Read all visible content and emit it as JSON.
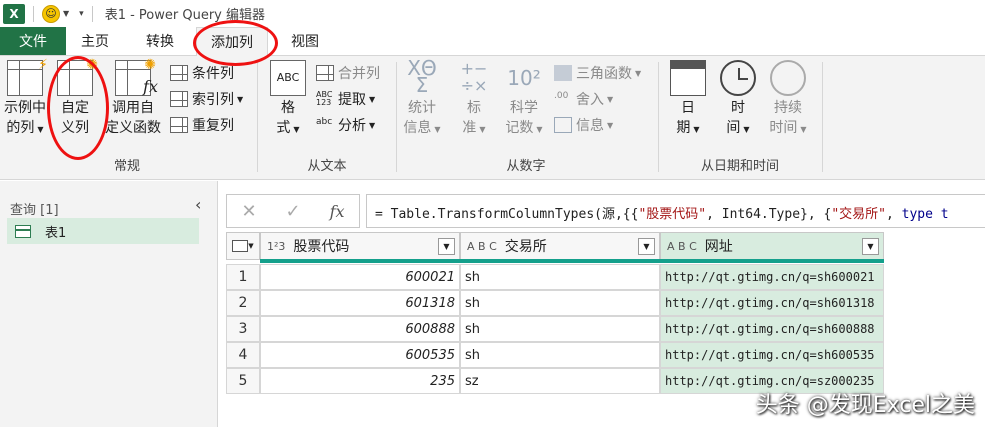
{
  "titlebar": {
    "app_icon": "X",
    "title": "表1 - Power Query 编辑器"
  },
  "menu": {
    "file": "文件",
    "home": "主页",
    "transform": "转换",
    "add_column": "添加列",
    "view": "视图"
  },
  "ribbon": {
    "general": {
      "label": "常规",
      "example_col": [
        "示例中",
        "的列"
      ],
      "custom_col": [
        "自定",
        "义列"
      ],
      "invoke_fn": [
        "调用自",
        "定义函数"
      ],
      "conditional_col": "条件列",
      "index_col": "索引列",
      "duplicate_col": "重复列"
    },
    "from_text": {
      "label": "从文本",
      "format": [
        "格",
        "式"
      ],
      "merge_col": "合并列",
      "extract": "提取",
      "parse": "分析"
    },
    "from_number": {
      "label": "从数字",
      "statistics": [
        "统计",
        "信息"
      ],
      "standard": [
        "标",
        "准"
      ],
      "scientific": [
        "科学",
        "记数"
      ],
      "trig": "三角函数",
      "rounding": "舍入",
      "information": "信息"
    },
    "from_datetime": {
      "label": "从日期和时间",
      "date": [
        "日",
        "期"
      ],
      "time": [
        "时",
        "间"
      ],
      "duration": [
        "持续",
        "时间"
      ]
    }
  },
  "queries": {
    "header": "查询 [1]",
    "items": [
      {
        "name": "表1"
      }
    ]
  },
  "formula": {
    "prefix": "= Table.TransformColumnTypes(源,{{",
    "s1": "\"股票代码\"",
    "mid1": ", Int64.Type}, {",
    "s2": "\"交易所\"",
    "mid2": ", ",
    "kw": "type t"
  },
  "table": {
    "columns": [
      {
        "type": "1²3",
        "name": "股票代码"
      },
      {
        "type": "A B C",
        "name": "交易所"
      },
      {
        "type": "A B C",
        "name": "网址"
      }
    ],
    "rows": [
      {
        "n": "1",
        "code": "600021",
        "ex": "sh",
        "url": "http://qt.gtimg.cn/q=sh600021"
      },
      {
        "n": "2",
        "code": "601318",
        "ex": "sh",
        "url": "http://qt.gtimg.cn/q=sh601318"
      },
      {
        "n": "3",
        "code": "600888",
        "ex": "sh",
        "url": "http://qt.gtimg.cn/q=sh600888"
      },
      {
        "n": "4",
        "code": "600535",
        "ex": "sh",
        "url": "http://qt.gtimg.cn/q=sh600535"
      },
      {
        "n": "5",
        "code": "235",
        "ex": "sz",
        "url": "http://qt.gtimg.cn/q=sz000235"
      }
    ]
  },
  "watermark": "头条 @发现Excel之美",
  "colors": {
    "excel_green": "#217346",
    "selected_green": "#d8ecdf",
    "teal": "#14a08c",
    "annotation_red": "#e11111"
  }
}
